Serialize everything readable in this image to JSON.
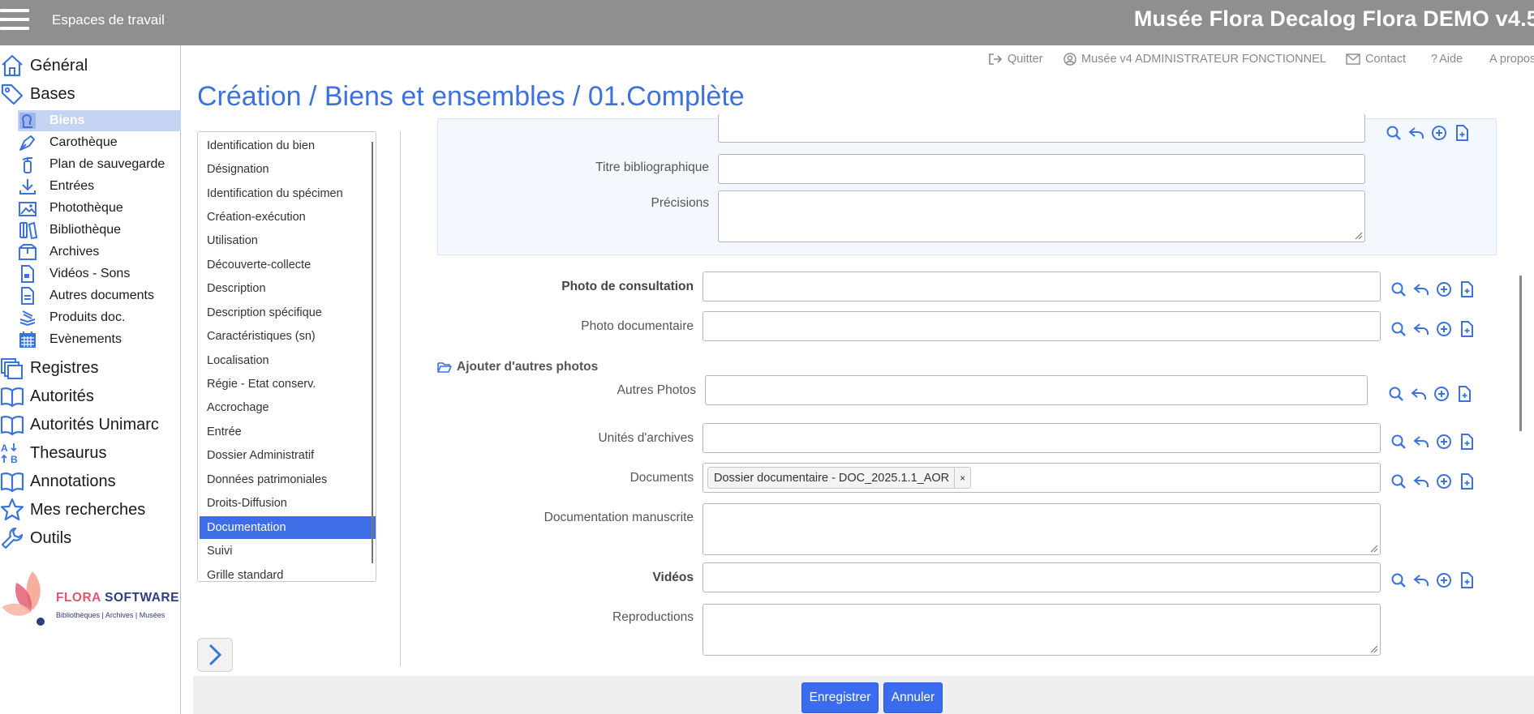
{
  "header": {
    "workspaces_label": "Espaces de travail",
    "app_title": "Musée Flora Decalog Flora DEMO v4.5"
  },
  "sidebar": {
    "main_items": [
      {
        "label": "Général",
        "icon": "home-icon"
      },
      {
        "label": "Bases",
        "icon": "tag-icon"
      }
    ],
    "sub_items": [
      {
        "label": "Biens",
        "icon": "object-icon",
        "active": true
      },
      {
        "label": "Carothèque",
        "icon": "pen-nib-icon"
      },
      {
        "label": "Plan de sauvegarde",
        "icon": "fire-extinguisher-icon"
      },
      {
        "label": "Entrées",
        "icon": "download-icon"
      },
      {
        "label": "Photothèque",
        "icon": "images-icon"
      },
      {
        "label": "Bibliothèque",
        "icon": "books-icon"
      },
      {
        "label": "Archives",
        "icon": "box-icon"
      },
      {
        "label": "Vidéos - Sons",
        "icon": "video-file-icon"
      },
      {
        "label": "Autres documents",
        "icon": "document-icon"
      },
      {
        "label": "Produits doc.",
        "icon": "stack-icon"
      },
      {
        "label": "Evènements",
        "icon": "calendar-icon"
      }
    ],
    "lower_items": [
      {
        "label": "Registres",
        "icon": "registers-icon"
      },
      {
        "label": "Autorités",
        "icon": "open-book-icon"
      },
      {
        "label": "Autorités Unimarc",
        "icon": "open-book-icon"
      },
      {
        "label": "Thesaurus",
        "icon": "sort-alpha-icon"
      },
      {
        "label": "Annotations",
        "icon": "open-book-icon"
      },
      {
        "label": "Mes recherches",
        "icon": "star-icon"
      },
      {
        "label": "Outils",
        "icon": "wrench-icon"
      }
    ],
    "logo": {
      "brand_part1": "FLORA",
      "brand_part2": " SOFTWARE",
      "tagline": "Bibliothèques | Archives | Musées"
    }
  },
  "utility_links": {
    "quit": "Quitter",
    "user": "Musée v4 ADMINISTRATEUR FONCTIONNEL",
    "contact": "Contact",
    "help": "Aide",
    "about": "A propos"
  },
  "page": {
    "title": "Création / Biens et ensembles / 01.Complète"
  },
  "sections": [
    "Identification du bien",
    "Désignation",
    "Identification du spécimen",
    "Création-exécution",
    "Utilisation",
    "Découverte-collecte",
    "Description",
    "Description spécifique",
    "Caractéristiques (sn)",
    "Localisation",
    "Régie - Etat conserv.",
    "Accrochage",
    "Entrée",
    "Dossier Administratif",
    "Données patrimoniales",
    "Droits-Diffusion",
    "Documentation",
    "Suivi",
    "Grille standard"
  ],
  "active_section": "Documentation",
  "form": {
    "titre_bibliographique": {
      "label": "Titre bibliographique",
      "value": ""
    },
    "precisions": {
      "label": "Précisions",
      "value": ""
    },
    "photo_consultation": {
      "label": "Photo de consultation",
      "value": ""
    },
    "photo_documentaire": {
      "label": "Photo documentaire",
      "value": ""
    },
    "add_photos": {
      "label": "Ajouter d'autres photos"
    },
    "autres_photos": {
      "label": "Autres Photos",
      "value": ""
    },
    "unites_archives": {
      "label": "Unités d'archives",
      "value": ""
    },
    "documents": {
      "label": "Documents",
      "chip": "Dossier documentaire - DOC_2025.1.1_AOR",
      "chip_remove": "×"
    },
    "documentation_manuscrite": {
      "label": "Documentation manuscrite",
      "value": ""
    },
    "videos": {
      "label": "Vidéos",
      "value": ""
    },
    "reproductions": {
      "label": "Reproductions",
      "value": ""
    }
  },
  "footer": {
    "save_label": "Enregistrer",
    "cancel_label": "Annuler"
  },
  "colors": {
    "accent": "#3d72dd",
    "button": "#3b6cf0",
    "header_bg": "#8f8f8f",
    "active_section_bg": "#3d6ee6"
  }
}
